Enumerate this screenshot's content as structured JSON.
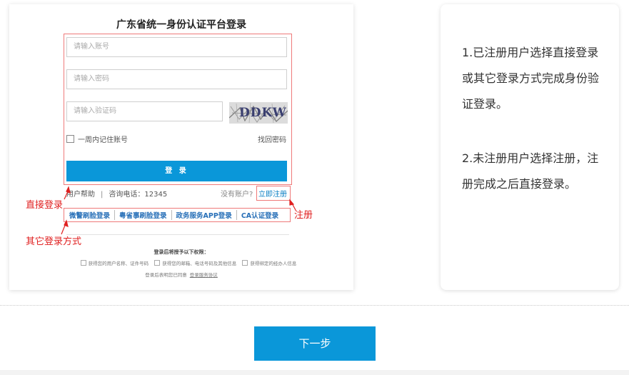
{
  "login_panel": {
    "title": "广东省统一身份认证平台登录",
    "account_placeholder": "请输入账号",
    "password_placeholder": "请输入密码",
    "captcha_placeholder": "请输入验证码",
    "captcha_text": "DDKW",
    "remember_label": "一周内记住账号",
    "forgot_password": "找回密码",
    "login_button": "登 录",
    "user_help": "用户帮助",
    "divider": "|",
    "hotline": "咨询电话：12345",
    "no_account": "没有账户?",
    "register_now": "立即注册",
    "other_logins": [
      "微警刷脸登录",
      "粤省事刷脸登录",
      "政务服务APP登录",
      "CA认证登录"
    ],
    "auth_title": "登录后将授予以下权限：",
    "auth_items": [
      "获得您的用户名称、证件号码",
      "获得您的邮箱、电话号码及其他信息",
      "获得绑定的经办人信息"
    ],
    "auth_agree": "登录后表明您已同意",
    "service_agreement": "登录服务协议"
  },
  "annotations": {
    "direct_login": "直接登录",
    "other_methods": "其它登录方式",
    "register": "注册"
  },
  "instructions": {
    "step1": "1.已注册用户选择直接登录或其它登录方式完成身份验证登录。",
    "step2": "2.未注册用户选择注册，注册完成之后直接登录。"
  },
  "next_button": "下一步",
  "colors": {
    "primary": "#0a97d9",
    "annotation_red": "#e02020",
    "link_blue": "#2870b8"
  }
}
